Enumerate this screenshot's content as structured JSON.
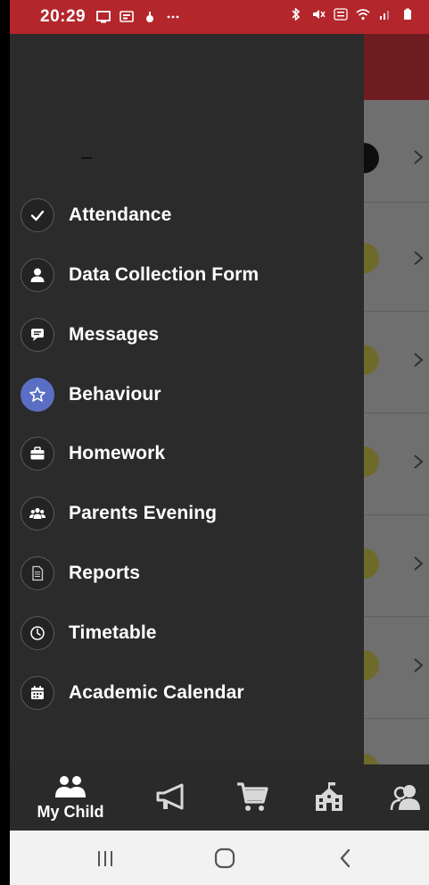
{
  "status_bar": {
    "time": "20:29",
    "left_icons": [
      "cast-icon",
      "notification-icon",
      "app-icon",
      "more-dots-icon"
    ],
    "right_icons": [
      "bluetooth-icon",
      "mute-icon",
      "volte-icon",
      "wifi-icon",
      "signal-icon",
      "battery-icon"
    ],
    "background_color": "#b3262b"
  },
  "drawer": {
    "items": [
      {
        "label": "Attendance",
        "icon": "check-icon",
        "active": false
      },
      {
        "label": "Data Collection Form",
        "icon": "person-icon",
        "active": false
      },
      {
        "label": "Messages",
        "icon": "chat-icon",
        "active": false
      },
      {
        "label": "Behaviour",
        "icon": "star-icon",
        "active": true
      },
      {
        "label": "Homework",
        "icon": "briefcase-icon",
        "active": false
      },
      {
        "label": "Parents Evening",
        "icon": "group-icon",
        "active": false
      },
      {
        "label": "Reports",
        "icon": "document-icon",
        "active": false
      },
      {
        "label": "Timetable",
        "icon": "clock-icon",
        "active": false
      },
      {
        "label": "Academic Calendar",
        "icon": "calendar-icon",
        "active": false
      }
    ],
    "active_color": "#5a6fc4"
  },
  "bottom_nav": {
    "items": [
      {
        "label": "My Child",
        "icon": "child-icon",
        "selected": true
      },
      {
        "label": "",
        "icon": "megaphone-icon",
        "selected": false
      },
      {
        "label": "",
        "icon": "cart-icon",
        "selected": false
      },
      {
        "label": "",
        "icon": "school-icon",
        "selected": false
      },
      {
        "label": "",
        "icon": "people-icon",
        "selected": false
      }
    ]
  },
  "system_nav": {
    "buttons": [
      "recent-apps-icon",
      "home-icon",
      "back-icon"
    ]
  }
}
